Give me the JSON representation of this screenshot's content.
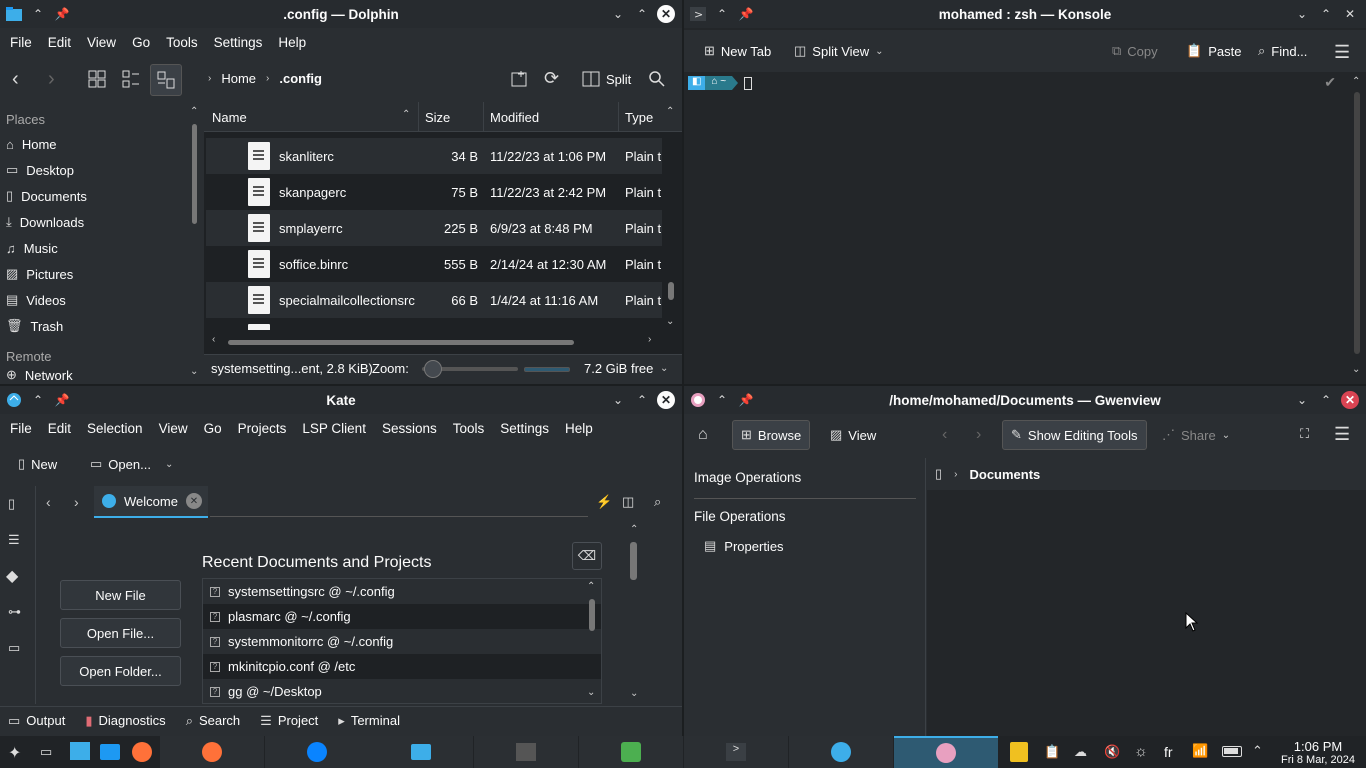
{
  "dolphin": {
    "title": ".config — Dolphin",
    "menu": [
      "File",
      "Edit",
      "View",
      "Go",
      "Tools",
      "Settings",
      "Help"
    ],
    "crumb_home": "Home",
    "crumb_current": ".config",
    "split": "Split",
    "places_header": "Places",
    "places": [
      "Home",
      "Desktop",
      "Documents",
      "Downloads",
      "Music",
      "Pictures",
      "Videos",
      "Trash"
    ],
    "remote_header": "Remote",
    "remote_item": "Network",
    "cols": {
      "name": "Name",
      "size": "Size",
      "modified": "Modified",
      "type": "Type"
    },
    "files": [
      {
        "name": "skanliterc",
        "size": "34 B",
        "modified": "11/22/23 at 1:06 PM",
        "type": "Plain text"
      },
      {
        "name": "skanpagerc",
        "size": "75 B",
        "modified": "11/22/23 at 2:42 PM",
        "type": "Plain text"
      },
      {
        "name": "smplayerrc",
        "size": "225 B",
        "modified": "6/9/23 at 8:48 PM",
        "type": "Plain text"
      },
      {
        "name": "soffice.binrc",
        "size": "555 B",
        "modified": "2/14/24 at 12:30 AM",
        "type": "Plain text"
      },
      {
        "name": "specialmailcollectionsrc",
        "size": "66 B",
        "modified": "1/4/24 at 11:16 AM",
        "type": "Plain text"
      }
    ],
    "status": "systemsetting...ent, 2.8 KiB)",
    "zoom_label": "Zoom:",
    "free": "7.2 GiB free"
  },
  "konsole": {
    "title": "mohamed : zsh — Konsole",
    "new_tab": "New Tab",
    "split_view": "Split View",
    "copy": "Copy",
    "paste": "Paste",
    "find": "Find...",
    "prompt_dir": "~"
  },
  "kate": {
    "title": "Kate",
    "menu": [
      "File",
      "Edit",
      "Selection",
      "View",
      "Go",
      "Projects",
      "LSP Client",
      "Sessions",
      "Tools",
      "Settings",
      "Help"
    ],
    "new": "New",
    "open": "Open...",
    "tab": "Welcome",
    "recent_title": "Recent Documents and Projects",
    "new_file": "New File",
    "open_file": "Open File...",
    "open_folder": "Open Folder...",
    "recent": [
      "systemsettingsrc @ ~/.config",
      "plasmarc @ ~/.config",
      "systemmonitorrc @ ~/.config",
      "mkinitcpio.conf @ /etc",
      "gg @ ~/Desktop"
    ],
    "bottom": [
      "Output",
      "Diagnostics",
      "Search",
      "Project",
      "Terminal"
    ]
  },
  "gwen": {
    "title": "/home/mohamed/Documents — Gwenview",
    "browse": "Browse",
    "view": "View",
    "editing": "Show Editing Tools",
    "share": "Share",
    "image_ops": "Image Operations",
    "file_ops": "File Operations",
    "properties": "Properties",
    "crumb": "Documents"
  },
  "clock": {
    "time": "1:06 PM",
    "date": "Fri 8 Mar, 2024"
  },
  "tray": {
    "lang": "fr"
  },
  "colors": {
    "accent": "#3daee9",
    "close": "#da4453"
  }
}
